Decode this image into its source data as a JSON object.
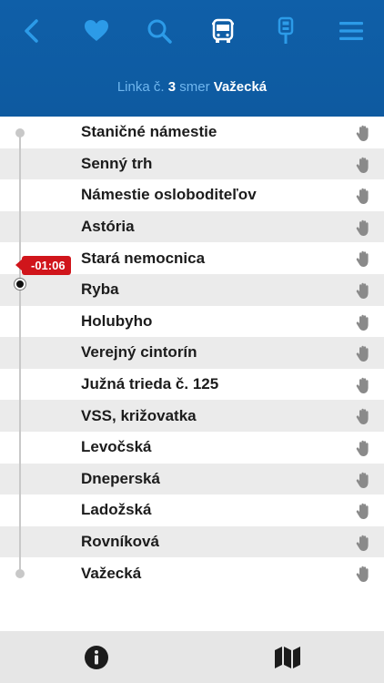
{
  "header": {
    "subtitle": {
      "prefix": "Linka č.",
      "line_number": "3",
      "direction_word": "smer",
      "destination": "Važecká"
    },
    "toolbar_icons": [
      "back-icon",
      "heart-icon",
      "search-icon",
      "bus-icon",
      "bus-stop-icon",
      "menu-icon"
    ]
  },
  "stops": [
    {
      "name": "Staničné námestie"
    },
    {
      "name": "Senný trh"
    },
    {
      "name": "Námestie osloboditeľov"
    },
    {
      "name": "Astória"
    },
    {
      "name": "Stará nemocnica"
    },
    {
      "name": "Ryba"
    },
    {
      "name": "Holubyho"
    },
    {
      "name": "Verejný cintorín"
    },
    {
      "name": "Južná trieda č. 125"
    },
    {
      "name": "VSS, križovatka"
    },
    {
      "name": "Levočská"
    },
    {
      "name": "Dneperská"
    },
    {
      "name": "Ladožská"
    },
    {
      "name": "Rovníková"
    },
    {
      "name": "Važecká"
    }
  ],
  "vehicle": {
    "delay": "-01:06"
  },
  "footer_icons": [
    "info-icon",
    "map-icon"
  ],
  "colors": {
    "header": "#0f5fa8",
    "accent": "#2c9be8",
    "delay": "#d0151b"
  }
}
